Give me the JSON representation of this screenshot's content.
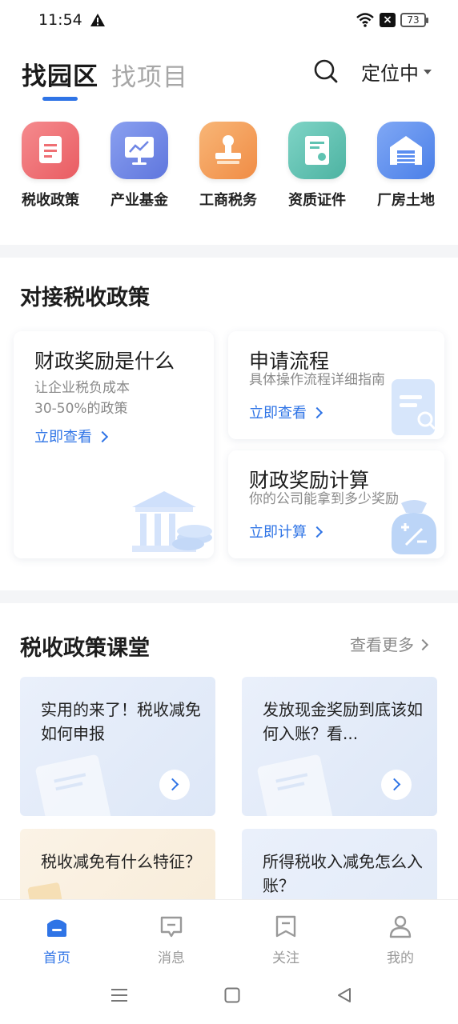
{
  "status": {
    "time": "11:54",
    "battery": "73"
  },
  "header": {
    "tab_active": "找园区",
    "tab_inactive": "找项目",
    "location": "定位中"
  },
  "categories": [
    {
      "label": "税收政策",
      "icon": "document-icon",
      "color": "#ef6f73"
    },
    {
      "label": "产业基金",
      "icon": "chart-board-icon",
      "color": "#6f86e5"
    },
    {
      "label": "工商税务",
      "icon": "stamp-icon",
      "color": "#f4a25e"
    },
    {
      "label": "资质证件",
      "icon": "certificate-icon",
      "color": "#5fc3b2"
    },
    {
      "label": "厂房土地",
      "icon": "warehouse-icon",
      "color": "#5b8ef0"
    }
  ],
  "policy": {
    "title": "对接税收政策",
    "cards": [
      {
        "title": "财政奖励是什么",
        "sub1": "让企业税负成本",
        "sub2": "30-50%的政策",
        "link": "立即查看"
      },
      {
        "title": "申请流程",
        "sub1": "具体操作流程详细指南",
        "link": "立即查看"
      },
      {
        "title": "财政奖励计算",
        "sub1": "你的公司能拿到多少奖励",
        "link": "立即计算"
      }
    ]
  },
  "classroom": {
    "title": "税收政策课堂",
    "more": "查看更多",
    "items": [
      {
        "title": "实用的来了！税收减免如何申报"
      },
      {
        "title": "发放现金奖励到底该如何入账？看..."
      },
      {
        "title": "税收减免有什么特征？"
      },
      {
        "title": "所得税收入减免怎么入账？"
      }
    ]
  },
  "tabbar": [
    {
      "label": "首页",
      "icon": "home-icon",
      "active": true
    },
    {
      "label": "消息",
      "icon": "message-icon",
      "active": false
    },
    {
      "label": "关注",
      "icon": "bookmark-icon",
      "active": false
    },
    {
      "label": "我的",
      "icon": "user-icon",
      "active": false
    }
  ],
  "colors": {
    "accent": "#2f74e6",
    "muted": "#8a8a8a",
    "bg": "#f4f5f7"
  }
}
